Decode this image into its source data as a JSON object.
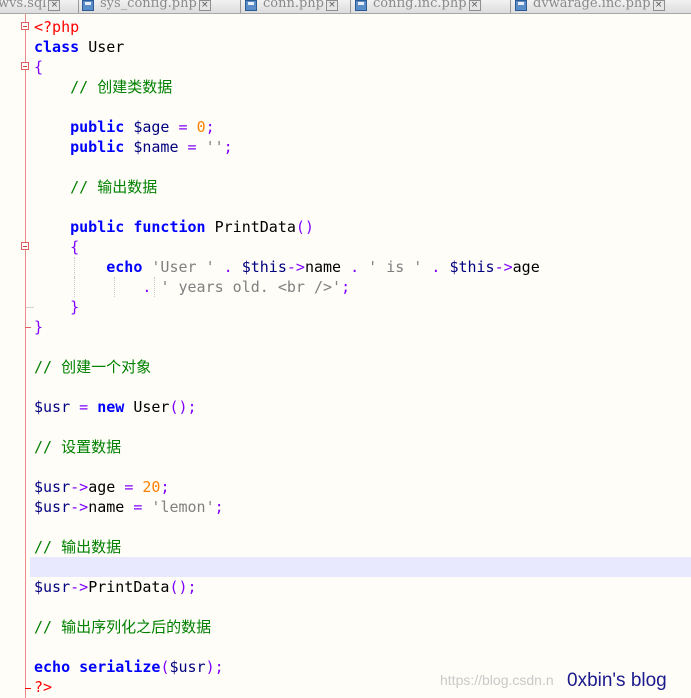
{
  "tabs": [
    {
      "label": "wvs.sql"
    },
    {
      "label": "sys_config.php"
    },
    {
      "label": "conn.php"
    },
    {
      "label": "config.inc.php"
    },
    {
      "label": "dvwarage.inc.php"
    }
  ],
  "code": {
    "open_tag": "<?php",
    "class_kw": "class",
    "class_name": "User",
    "brace_open": "{",
    "brace_close": "}",
    "comment_create_class_data": "// 创建类数据",
    "public_kw": "public",
    "var_age": "$age",
    "eq": "=",
    "age_default": "0",
    "semi": ";",
    "var_name": "$name",
    "name_default": "''",
    "comment_output_data": "// 输出数据",
    "function_kw": "function",
    "func_name": "PrintData",
    "parens": "()",
    "echo_kw": "echo",
    "str_user": "'User '",
    "dot": ".",
    "this_var": "$this",
    "arrow": "->",
    "prop_name": "name",
    "str_is": "' is '",
    "prop_age": "age",
    "str_years": "' years old. <br />'",
    "comment_create_object": "// 创建一个对象",
    "var_usr": "$usr",
    "new_kw": "new",
    "comment_set_data": "// 设置数据",
    "age_value": "20",
    "name_value": "'lemon'",
    "comment_output_data2": "// 输出数据",
    "comment_output_serialized": "// 输出序列化之后的数据",
    "serialize_kw": "serialize",
    "paren_open": "(",
    "paren_close": ")",
    "close_tag": "?>"
  },
  "watermark": {
    "url": "https://blog.csdn.n",
    "blog": "0xbin's blog"
  },
  "colors": {
    "keyword": "#0000ff",
    "variable": "#000080",
    "operator": "#8000ff",
    "number": "#ff8000",
    "string": "#808080",
    "comment": "#008000",
    "php_tag": "#ff0000",
    "current_line": "#e8e8ff",
    "background": "#fffdf7"
  }
}
